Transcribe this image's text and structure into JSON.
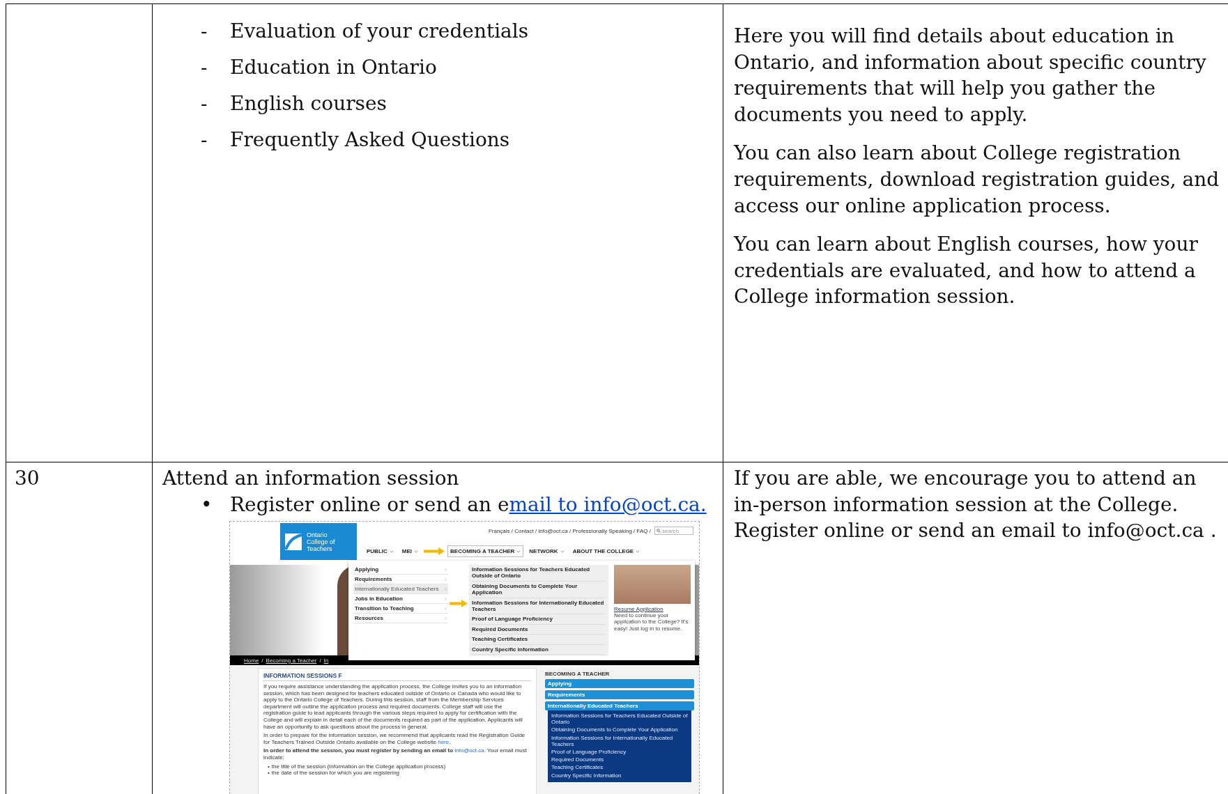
{
  "table": {
    "rows": [
      {
        "items": [
          {
            "marker": "-",
            "text": "Evaluation of your credentials"
          },
          {
            "marker": "-",
            "text": "Education in Ontario"
          },
          {
            "marker": "-",
            "text": "English courses"
          },
          {
            "marker": "-",
            "text": "Frequently Asked Questions"
          }
        ],
        "description": [
          "Here you will find details about education in Ontario, and information about specific country requirements that will help you gather the documents you need to apply.",
          "You can also learn about College registration requirements, download registration guides, and access our online application process.",
          "You can learn about English courses, how your credentials are evaluated, and how to attend a College information session."
        ]
      },
      {
        "number": "30",
        "heading": "Attend an information session",
        "items": [
          {
            "marker": "•",
            "text": "Register online or send an e",
            "link": "mail to info@oct.ca."
          }
        ],
        "description": [
          "If you are able, we encourage you to attend an in-person information session at the College. Register online or send an email to info@oct.ca ."
        ]
      }
    ]
  },
  "embedded_screenshot": {
    "logo_text": "Ontario College of Teachers",
    "top_links": "Français / Contact / info@oct.ca / Professionally Speaking / FAQ /",
    "search": {
      "placeholder": "search"
    },
    "nav": [
      {
        "label": "PUBLIC",
        "selected": false
      },
      {
        "label": "MEI",
        "selected": false
      },
      {
        "label": "BECOMING A TEACHER",
        "selected": true
      },
      {
        "label": "NETWORK",
        "selected": false
      },
      {
        "label": "ABOUT THE COLLEGE",
        "selected": false
      }
    ],
    "menu": {
      "primary": [
        {
          "label": "Applying",
          "selected": false
        },
        {
          "label": "Requirements",
          "selected": false
        },
        {
          "label": "Internationally Educated Teachers",
          "selected": true
        },
        {
          "label": "Jobs in Education",
          "selected": false
        },
        {
          "label": "Transition to Teaching",
          "selected": false
        },
        {
          "label": "Resources",
          "selected": false
        }
      ],
      "secondary": [
        "Information Sessions for Teachers Educated Outside of Ontario",
        "Obtaining Documents to Complete Your Application",
        "Information Sessions for Internationally Educated Teachers",
        "Proof of Language Proficiency",
        "Required Documents",
        "Teaching Certificates",
        "Country Specific Information"
      ],
      "promo_link": "Resume Application",
      "promo_text": "Need to continue your application to the College? It's easy! Just log in to resume."
    },
    "breadcrumb": [
      "Home",
      "/",
      "Becoming a Teacher",
      "/",
      "In"
    ],
    "article": {
      "heading": "INFORMATION SESSIONS F",
      "paragraphs": [
        {
          "text": "If you require assistance understanding the application process, the College invites you to an information session, which has been designed for teachers educated outside of Ontario or Canada who would like to apply to the Ontario College of Teachers. During this session, staff from the Membership Services department will outline the application process and required documents. College staff will use the registration guide to lead applicants through the various steps required to apply for certification with the College and will explain in detail each of the documents required as part of the application.  Applicants will have an opportunity to ask questions about the process in general."
        },
        {
          "text": "In order to prepare for the information session, we recommend that applicants read the Registration Guide for Teachers Trained Outside Ontario available on the College website ",
          "link": "here",
          "after": "."
        },
        {
          "text": "**In order to attend the session, you must register by sending an email to** ",
          "link": "info@oct.ca",
          "after": ". Your email must indicate:"
        }
      ],
      "bullets": [
        "the title of the session (Information on the College application process)",
        "the date of the session for which you are registering"
      ]
    },
    "sidebar": {
      "heading": "BECOMING A TEACHER",
      "items": [
        {
          "label": "Applying",
          "expanded": false
        },
        {
          "label": "Requirements",
          "expanded": false
        },
        {
          "label": "Internationally Educated Teachers",
          "expanded": true,
          "children": [
            "Information Sessions for Teachers Educated Outside of Ontario",
            "Obtaining Documents to Complete Your Application",
            "Information Sessions for Internationally Educated Teachers",
            "Proof of Language Proficiency",
            "Required Documents",
            "Teaching Certificates",
            "Country Specific Information"
          ]
        }
      ]
    }
  }
}
